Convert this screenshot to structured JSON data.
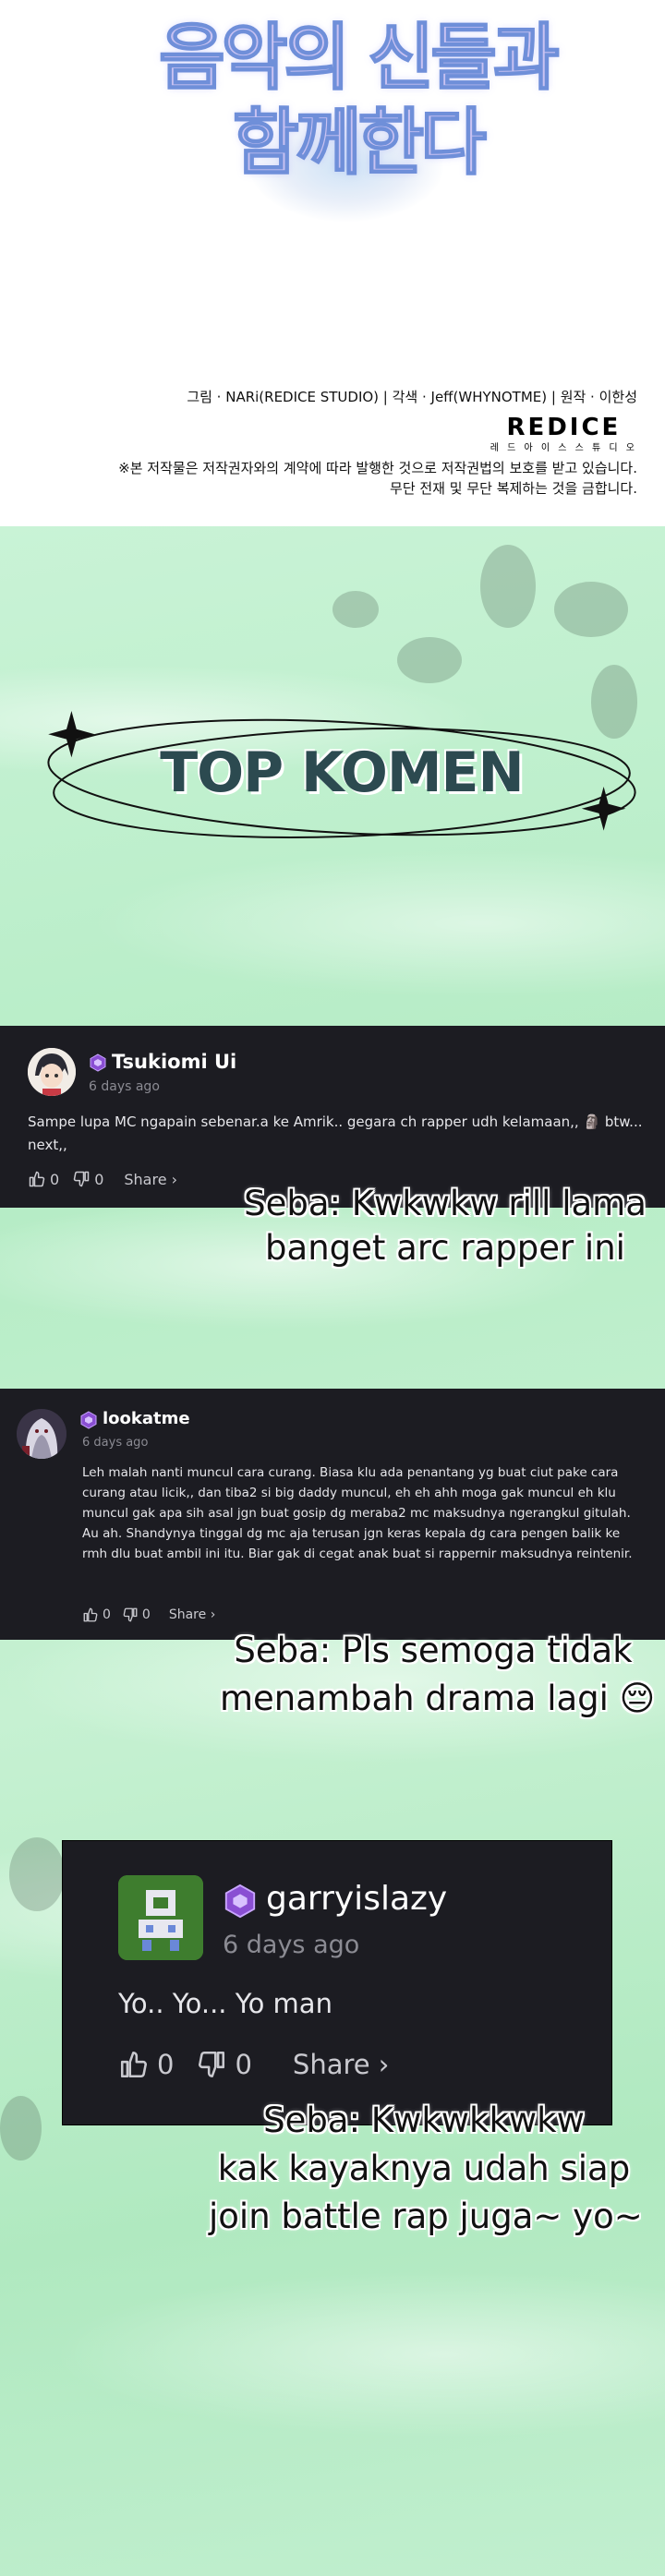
{
  "title": {
    "line1": "음악의 신들과",
    "line2": "함께한다"
  },
  "credits": {
    "line": "그림 · NARi(REDICE STUDIO) | 각색 · Jeff(WHYNOTME) | 원작 · 이한성",
    "logo_word": "REDICE",
    "logo_sub": "레 드 아 이 스   스 튜 디 오",
    "notice_line1": "※본 저작물은 저작권자와의 계약에 따라 발행한 것으로 저작권법의 보호를 받고 있습니다.",
    "notice_line2": "무단 전재 및 무단 복제하는 것을 금합니다."
  },
  "heading": "TOP KOMEN",
  "comments": [
    {
      "username": "Tsukiomi Ui",
      "time": "6 days ago",
      "text": "Sampe lupa MC ngapain sebenar.a ke Amrik.. gegara ch rapper udh kelamaan,, 🗿 btw... next,,",
      "likes": "0",
      "dislikes": "0",
      "share": "Share ›",
      "caption_line1": "Seba: Kwkwkw rill lama",
      "caption_line2": "banget arc rapper ini"
    },
    {
      "username": "lookatme",
      "time": "6 days ago",
      "text": "Leh malah nanti muncul cara curang. Biasa klu ada penantang yg buat ciut pake cara curang atau licik,, dan tiba2 si big daddy muncul, eh eh ahh moga gak muncul eh klu muncul gak apa sih asal jgn buat gosip dg meraba2 mc maksudnya ngerangkul gitulah. Au ah. Shandynya tinggal dg mc aja terusan jgn keras kepala dg cara pengen balik ke rmh dlu buat ambil ini itu. Biar gak di cegat anak buat si rappernir maksudnya reintenir.",
      "likes": "0",
      "dislikes": "0",
      "share": "Share ›",
      "caption_line1": "Seba: Pls semoga tidak",
      "caption_line2": "menambah drama lagi 😔"
    },
    {
      "username": "garryislazy",
      "time": "6 days ago",
      "text": "Yo.. Yo... Yo man",
      "likes": "0",
      "dislikes": "0",
      "share": "Share ›",
      "caption_line1": "Seba: Kwkwkkwkw",
      "caption_line2": "kak kayaknya udah siap",
      "caption_line3": "join battle rap juga~ yo~"
    }
  ],
  "colors": {
    "card_bg": "#1c1c22",
    "badge": "#8a4fd3",
    "green_bg": "#c1efcf",
    "heading": "#2c4a50"
  },
  "icons": [
    "thumbs-up-icon",
    "thumbs-down-icon",
    "star-sparkle-icon",
    "hexagon-badge-icon"
  ]
}
